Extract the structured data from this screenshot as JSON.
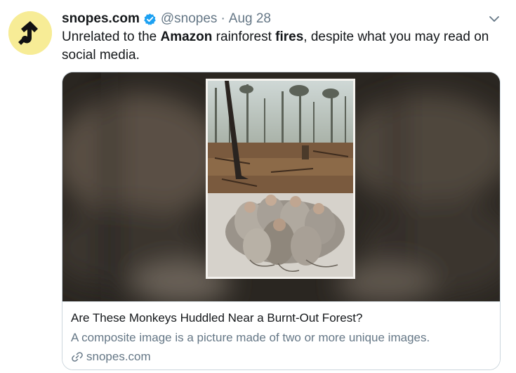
{
  "tweet": {
    "display_name": "snopes.com",
    "handle": "@snopes",
    "separator": "·",
    "date": "Aug 28",
    "text_parts": {
      "p1": "Unrelated to the ",
      "p2": "Amazon",
      "p3": " rainforest ",
      "p4": "fires",
      "p5": ", despite what you may read on social media."
    },
    "avatar_icon": "snopes-logo-icon",
    "verified_icon": "verified-badge-icon",
    "menu_icon": "chevron-down-icon"
  },
  "card": {
    "title": "Are These Monkeys Huddled Near a Burnt-Out Forest?",
    "description": "A composite image is a picture made of two or more unique images.",
    "domain": "snopes.com",
    "domain_icon": "link-icon"
  },
  "colors": {
    "text": "#14171a",
    "secondary": "#657786",
    "verified": "#1da1f2",
    "avatar_bg": "#f7ec96",
    "border": "#ccd6dd"
  }
}
